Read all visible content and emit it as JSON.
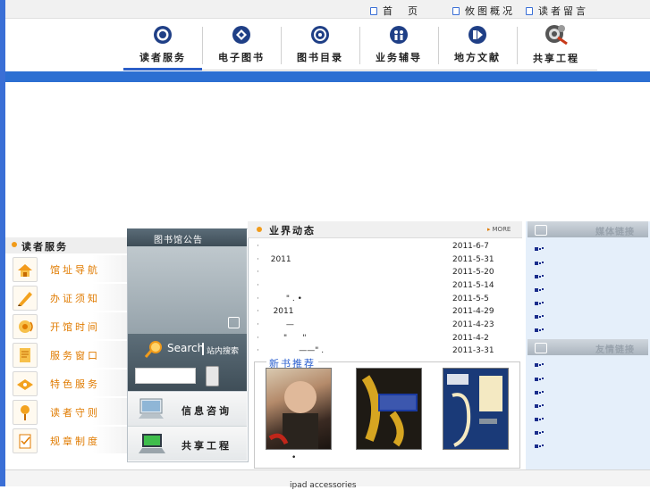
{
  "top_links": [
    {
      "label": "首　页"
    },
    {
      "label": "攸图概况"
    },
    {
      "label": "读者留言"
    }
  ],
  "nav": [
    {
      "label": "读者服务",
      "icon": "target-icon"
    },
    {
      "label": "电子图书",
      "icon": "diamond-icon"
    },
    {
      "label": "图书目录",
      "icon": "ring-icon"
    },
    {
      "label": "业务辅导",
      "icon": "people-icon"
    },
    {
      "label": "地方文献",
      "icon": "play-icon"
    },
    {
      "label": "共享工程",
      "icon": "gear-icon"
    }
  ],
  "sidebar": {
    "title": "读者服务",
    "items": [
      {
        "label": "馆址导航"
      },
      {
        "label": "办证须知"
      },
      {
        "label": "开馆时间"
      },
      {
        "label": "服务窗口"
      },
      {
        "label": "特色服务"
      },
      {
        "label": "读者守则"
      },
      {
        "label": "规章制度"
      }
    ]
  },
  "notice": {
    "title": "图书馆公告",
    "search_title": "Search",
    "search_sub": "站内搜索",
    "search_value": "",
    "buttons": [
      {
        "label": "信息咨询"
      },
      {
        "label": "共享工程"
      }
    ]
  },
  "news": {
    "title": "业界动态",
    "more_label": "MORE",
    "rows": [
      {
        "title": "",
        "date": "2011-6-7"
      },
      {
        "title": "  2011",
        "date": "2011-5-31"
      },
      {
        "title": "",
        "date": "2011-5-20"
      },
      {
        "title": "",
        "date": "2011-5-14"
      },
      {
        "title": "        \" . •",
        "date": "2011-5-5"
      },
      {
        "title": "   2011",
        "date": "2011-4-29"
      },
      {
        "title": "        —",
        "date": "2011-4-23"
      },
      {
        "title": "       \"      \"",
        "date": "2011-4-2"
      },
      {
        "title": "             ——\" .",
        "date": "2011-3-31"
      }
    ]
  },
  "books": {
    "title": "新书推荐",
    "dot": "•",
    "items": [
      {
        "cover_color": "#8a2a1a"
      },
      {
        "cover_color": "#1e1a14"
      },
      {
        "cover_color": "#1a3a78"
      }
    ]
  },
  "right_blocks": [
    {
      "title": "媒体链接",
      "item_count": 7
    },
    {
      "title": "友情链接",
      "item_count": 7
    }
  ],
  "footer": {
    "text": "ipad accessories"
  },
  "colors": {
    "accent_blue": "#2c6fd2",
    "accent_orange": "#e07b00"
  }
}
